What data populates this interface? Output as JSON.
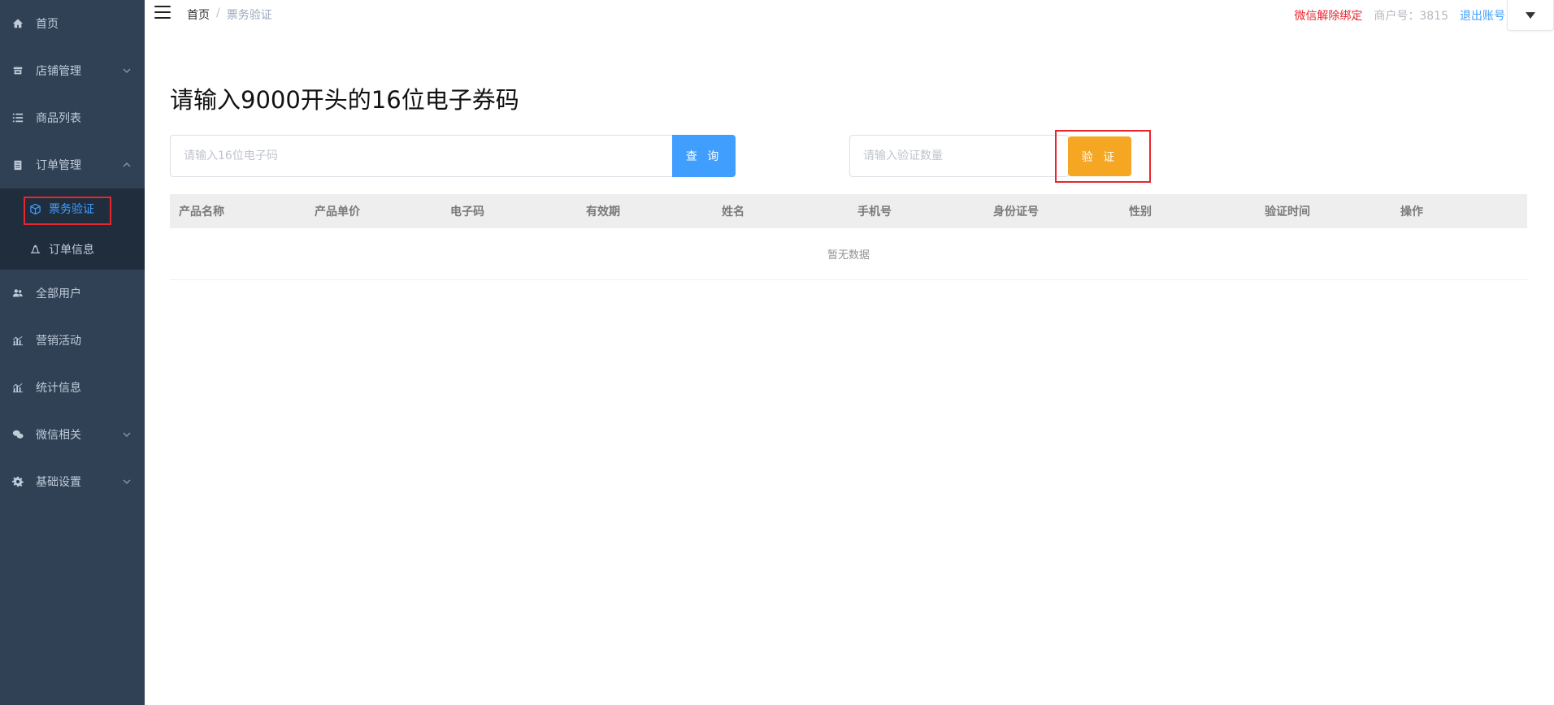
{
  "sidebar": {
    "items": [
      {
        "label": "首页",
        "icon": "home-icon"
      },
      {
        "label": "店铺管理",
        "icon": "store-icon",
        "has_children": true
      },
      {
        "label": "商品列表",
        "icon": "list-icon"
      },
      {
        "label": "订单管理",
        "icon": "clipboard-icon",
        "expanded": true,
        "children": [
          {
            "label": "票务验证",
            "icon": "cube-icon",
            "active": true
          },
          {
            "label": "订单信息",
            "icon": "bell-icon"
          }
        ]
      },
      {
        "label": "全部用户",
        "icon": "users-icon"
      },
      {
        "label": "营销活动",
        "icon": "chart-icon"
      },
      {
        "label": "统计信息",
        "icon": "chart-icon"
      },
      {
        "label": "微信相关",
        "icon": "wechat-icon",
        "has_children": true
      },
      {
        "label": "基础设置",
        "icon": "gear-icon",
        "has_children": true
      }
    ]
  },
  "header": {
    "breadcrumb": [
      "首页",
      "票务验证"
    ],
    "unbind_wechat": "微信解除绑定",
    "merchant_no": "商户号：3815",
    "logout": "退出账号"
  },
  "main": {
    "title": "请输入9000开头的16位电子券码",
    "code_placeholder": "请输入16位电子码",
    "query_label": "查 询",
    "qty_placeholder": "请输入验证数量",
    "verify_label": "验 证"
  },
  "table": {
    "columns": [
      "产品名称",
      "产品单价",
      "电子码",
      "有效期",
      "姓名",
      "手机号",
      "身份证号",
      "性别",
      "验证时间",
      "操作"
    ],
    "empty_text": "暂无数据"
  },
  "colors": {
    "sidebar_bg": "#304156",
    "submenu_bg": "#1f2d3d",
    "primary": "#409eff",
    "warning": "#f5a623",
    "danger": "#e8262d"
  }
}
